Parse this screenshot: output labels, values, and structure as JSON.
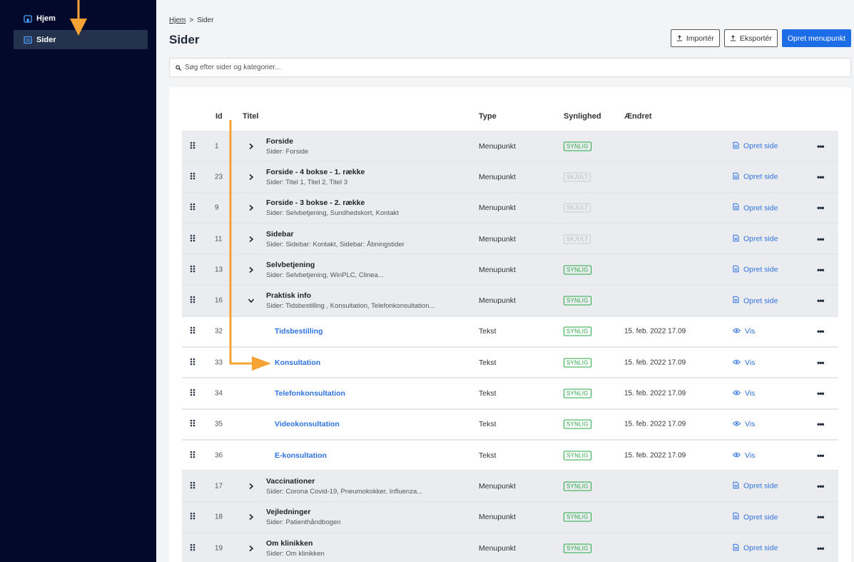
{
  "sidebar": {
    "items": [
      {
        "label": "Hjem",
        "icon": "home-icon"
      },
      {
        "label": "Sider",
        "icon": "pages-icon",
        "active": true
      }
    ]
  },
  "breadcrumb": {
    "root": "Hjem",
    "separator": ">",
    "current": "Sider"
  },
  "page": {
    "title": "Sider"
  },
  "toolbar": {
    "import_label": "Importér",
    "export_label": "Eksportér",
    "create_label": "Opret menupunkt"
  },
  "search": {
    "placeholder": "Søg efter sider og kategorier..."
  },
  "table": {
    "headers": {
      "id": "Id",
      "title": "Titel",
      "type": "Type",
      "visibility": "Synlighed",
      "changed": "Ændret"
    },
    "rows": [
      {
        "kind": "menu",
        "id": "1",
        "title": "Forside",
        "sub": "Sider: Forside",
        "type": "Menupunkt",
        "visibility": "SYNLIG",
        "visible": true,
        "changed": "",
        "action": "Opret side",
        "expanded": false
      },
      {
        "kind": "menu",
        "id": "23",
        "title": "Forside - 4 bokse - 1. række",
        "sub": "Sider: Titel 1, Titel 2, Titel 3",
        "type": "Menupunkt",
        "visibility": "SKJULT",
        "visible": false,
        "changed": "",
        "action": "Opret side",
        "expanded": false
      },
      {
        "kind": "menu",
        "id": "9",
        "title": "Forside - 3 bokse - 2. række",
        "sub": "Sider: Selvbetjening, Sundhedskort, Kontakt",
        "type": "Menupunkt",
        "visibility": "SKJULT",
        "visible": false,
        "changed": "",
        "action": "Opret side",
        "expanded": false
      },
      {
        "kind": "menu",
        "id": "11",
        "title": "Sidebar",
        "sub": "Sider: Sidebar: Kontakt, Sidebar: Åbningstider",
        "type": "Menupunkt",
        "visibility": "SKJULT",
        "visible": false,
        "changed": "",
        "action": "Opret side",
        "expanded": false
      },
      {
        "kind": "menu",
        "id": "13",
        "title": "Selvbetjening",
        "sub": "Sider: Selvbetjening, WinPLC, Clinea...",
        "type": "Menupunkt",
        "visibility": "SYNLIG",
        "visible": true,
        "changed": "",
        "action": "Opret side",
        "expanded": false
      },
      {
        "kind": "menu",
        "id": "16",
        "title": "Praktisk info",
        "sub": "Sider: Tidsbestilling , Konsultation, Telefonkonsultation...",
        "type": "Menupunkt",
        "visibility": "SYNLIG",
        "visible": true,
        "changed": "",
        "action": "Opret side",
        "expanded": true
      },
      {
        "kind": "text",
        "id": "32",
        "title": "Tidsbestilling",
        "type": "Tekst",
        "visibility": "SYNLIG",
        "visible": true,
        "changed": "15. feb. 2022 17.09",
        "action": "Vis"
      },
      {
        "kind": "text",
        "id": "33",
        "title": "Konsultation",
        "type": "Tekst",
        "visibility": "SYNLIG",
        "visible": true,
        "changed": "15. feb. 2022 17.09",
        "action": "Vis"
      },
      {
        "kind": "text",
        "id": "34",
        "title": "Telefonkonsultation",
        "type": "Tekst",
        "visibility": "SYNLIG",
        "visible": true,
        "changed": "15. feb. 2022 17.09",
        "action": "Vis"
      },
      {
        "kind": "text",
        "id": "35",
        "title": "Videokonsultation",
        "type": "Tekst",
        "visibility": "SYNLIG",
        "visible": true,
        "changed": "15. feb. 2022 17.09",
        "action": "Vis"
      },
      {
        "kind": "text",
        "id": "36",
        "title": "E-konsultation",
        "type": "Tekst",
        "visibility": "SYNLIG",
        "visible": true,
        "changed": "15. feb. 2022 17.09",
        "action": "Vis"
      },
      {
        "kind": "menu",
        "id": "17",
        "title": "Vaccinationer",
        "sub": "Sider: Corona Covid-19, Pneumokokker, Influenza...",
        "type": "Menupunkt",
        "visibility": "SYNLIG",
        "visible": true,
        "changed": "",
        "action": "Opret side",
        "expanded": false
      },
      {
        "kind": "menu",
        "id": "18",
        "title": "Vejledninger",
        "sub": "Sider: Patienthåndbogen",
        "type": "Menupunkt",
        "visibility": "SYNLIG",
        "visible": true,
        "changed": "",
        "action": "Opret side",
        "expanded": false
      },
      {
        "kind": "menu",
        "id": "19",
        "title": "Om klinikken",
        "sub": "Sider: Om klinikken",
        "type": "Menupunkt",
        "visibility": "SYNLIG",
        "visible": true,
        "changed": "",
        "action": "Opret side",
        "expanded": false
      }
    ]
  },
  "colors": {
    "sidebar_bg": "#02092a",
    "accent": "#1d6de6",
    "annotation_arrow": "#f7a234",
    "visible_green": "#28a745"
  }
}
